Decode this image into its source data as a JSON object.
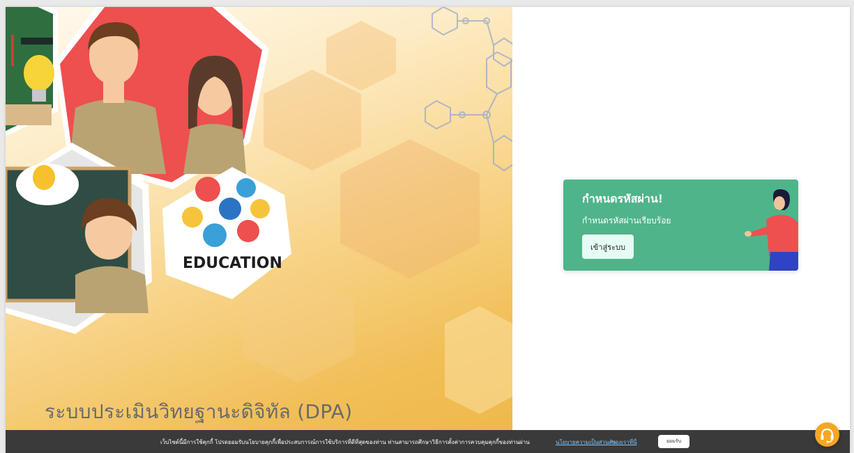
{
  "hero": {
    "badge_label": "EDUCATION",
    "title": "ระบบประเมินวิทยฐานะดิจิทัล (DPA)"
  },
  "card": {
    "title": "กำหนดรหัสผ่าน!",
    "message": "กำหนดรหัสผ่านเรียบร้อย",
    "login_button_label": "เข้าสู่ระบบ",
    "background_color": "#4fb48a"
  },
  "cookie_bar": {
    "message": "เว็บไซต์นี้มีการใช้คุกกี้ โปรดยอมรับนโยบายคุกกี้เพื่อประสบการณ์การใช้บริการที่ดีที่สุดของท่าน ท่านสามารถศึกษาวิธีการตั้งค่าการควบคุมคุกกี้ของท่านผ่าน",
    "privacy_link": "นโยบายความเป็นส่วนตัว",
    "here_link": "ของเราที่นี่",
    "accept_label": "ยอมรับ"
  },
  "support_button": {
    "icon": "headset-icon",
    "color": "#f5a623"
  }
}
